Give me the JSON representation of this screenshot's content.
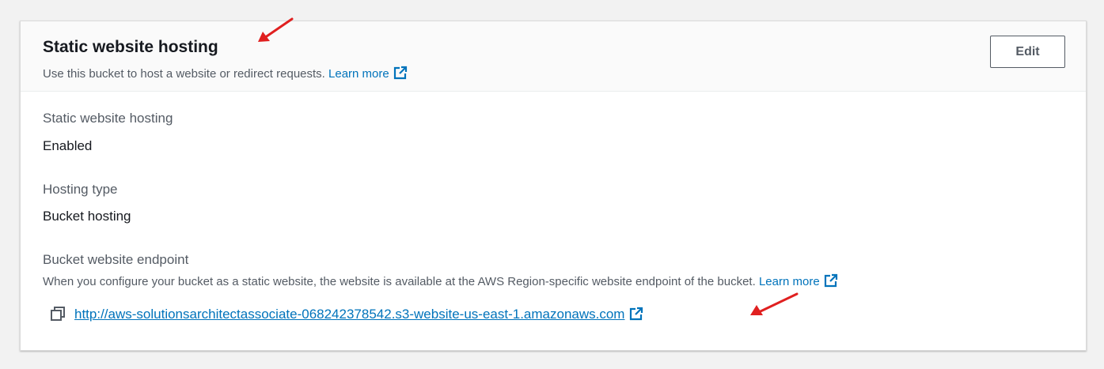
{
  "header": {
    "title": "Static website hosting",
    "description": "Use this bucket to host a website or redirect requests.",
    "learn_more": "Learn more",
    "edit_label": "Edit"
  },
  "fields": {
    "hosting": {
      "label": "Static website hosting",
      "value": "Enabled"
    },
    "hosting_type": {
      "label": "Hosting type",
      "value": "Bucket hosting"
    },
    "endpoint": {
      "label": "Bucket website endpoint",
      "description": "When you configure your bucket as a static website, the website is available at the AWS Region-specific website endpoint of the bucket.",
      "learn_more": "Learn more",
      "url": "http://aws-solutionsarchitectassociate-068242378542.s3-website-us-east-1.amazonaws.com"
    }
  },
  "icons": {
    "external": "external-link-icon",
    "copy": "copy-icon",
    "annotation": "red-arrow-annotation"
  },
  "colors": {
    "link": "#0073bb",
    "annotation": "#e02020",
    "header_bg": "#fafafa"
  }
}
